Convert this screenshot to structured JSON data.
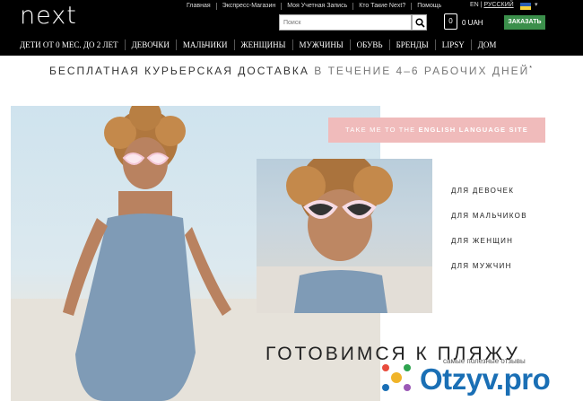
{
  "header": {
    "logo": "next",
    "top_links": [
      "Главная",
      "Экспресс-Магазин",
      "Моя Учетная Запись",
      "Кто Такие Next?",
      "Помощь"
    ],
    "lang_en": "EN",
    "lang_sep": " | ",
    "lang_ru": "РУССКИЙ",
    "search_placeholder": "Поиск",
    "cart_count": "0",
    "cart_total": "0 UAH",
    "order_label": "ЗАКАЗАТЬ",
    "accent_color": "#3b8f4b"
  },
  "nav": [
    "ДЕТИ ОТ 0 МЕС. ДО 2 ЛЕТ",
    "ДЕВОЧКИ",
    "МАЛЬЧИКИ",
    "ЖЕНЩИНЫ",
    "МУЖЧИНЫ",
    "ОБУВЬ",
    "БРЕНДЫ",
    "LIPSY",
    "ДОМ"
  ],
  "banner": {
    "strong": "БЕСПЛАТНАЯ КУРЬЕРСКАЯ ДОСТАВКА",
    "light": " В ТЕЧЕНИЕ 4–6 РАБОЧИХ ДНЕЙ",
    "mark": "*"
  },
  "hero": {
    "lang_button_pre": "TAKE ME TO THE ",
    "lang_button_bold": "ENGLISH LANGUAGE SITE",
    "categories": [
      "ДЛЯ ДЕВОЧЕК",
      "ДЛЯ МАЛЬЧИКОВ",
      "ДЛЯ ЖЕНЩИН",
      "ДЛЯ МУЖЧИН"
    ],
    "title": "ГОТОВИМСЯ К ПЛЯЖУ"
  },
  "watermark": {
    "tagline": "самые полезные отзывы",
    "brand": "Otzyv.pro"
  }
}
